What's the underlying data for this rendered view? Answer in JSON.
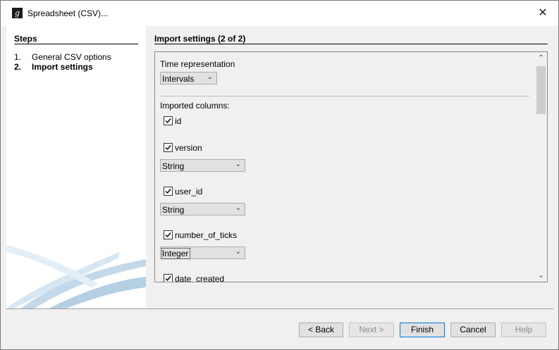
{
  "window": {
    "title": "Spreadsheet (CSV)...",
    "close_glyph": "✕"
  },
  "steps": {
    "heading": "Steps",
    "items": [
      {
        "num": "1.",
        "label": "General CSV options"
      },
      {
        "num": "2.",
        "label": "Import settings"
      }
    ]
  },
  "main": {
    "heading": "Import settings (2 of 2)",
    "time_representation": {
      "label": "Time representation",
      "value": "Intervals"
    },
    "imported_columns_label": "Imported columns:",
    "columns": [
      {
        "name": "id",
        "checked": true
      },
      {
        "name": "version",
        "checked": true,
        "type": "String"
      },
      {
        "name": "user_id",
        "checked": true,
        "type": "String"
      },
      {
        "name": "number_of_ticks",
        "checked": true,
        "type": "Integer"
      },
      {
        "name": "date_created",
        "checked": true
      }
    ]
  },
  "buttons": {
    "back": "< Back",
    "next": "Next >",
    "finish": "Finish",
    "cancel": "Cancel",
    "help": "Help"
  },
  "icons": {
    "app": "app-logo-icon",
    "chevron": "chevron-down-icon",
    "scroll_up": "scroll-up-icon",
    "scroll_down": "scroll-down-icon"
  },
  "colors": {
    "accent": "#0078d7",
    "panel": "#ffffff",
    "background": "#f0f0f0"
  }
}
